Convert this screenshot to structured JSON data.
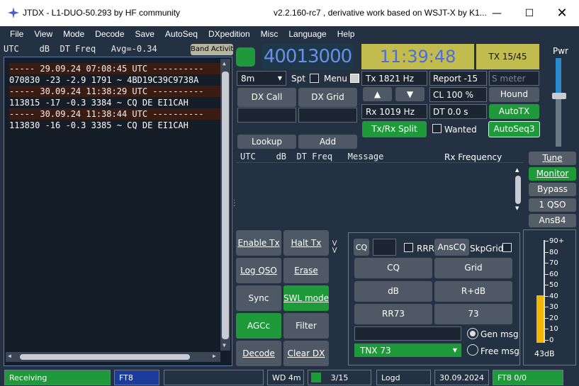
{
  "window": {
    "title": "JTDX - L1-DUO-50.293  by HF community",
    "version_text": "v2.2.160-rc7 , derivative work based on WSJT-X by K1..."
  },
  "menu": [
    "File",
    "View",
    "Mode",
    "Decode",
    "Save",
    "AutoSeq",
    "DXpedition",
    "Misc",
    "Language",
    "Help"
  ],
  "band_activity": {
    "header": "UTC    dB  DT Freq   Avg=-0.34",
    "header_button": "Band Activity",
    "lines": [
      {
        "text": "----- 29.09.24 07:08:45 UTC ----------",
        "sep": true
      },
      {
        "text": "070830 -23 -2.9 1791 ~ 4BD19C39C9738A",
        "sep": false
      },
      {
        "text": "----- 30.09.24 11:38:29 UTC ----------",
        "sep": true
      },
      {
        "text": "113815 -17 -0.3 3384 ~ CQ DE EI1CAH",
        "sep": false
      },
      {
        "text": "----- 30.09.24 11:38:44 UTC ----------",
        "sep": true
      },
      {
        "text": "113830 -16 -0.3 3385 ~ CQ DE EI1CAH",
        "sep": false
      }
    ]
  },
  "frequency": "40013000",
  "clock": "11:39:48",
  "tx_counter": "TX 15/45",
  "pwr_label": "Pwr",
  "band": "8m",
  "spt_label": "Spt",
  "menu_label": "Menu",
  "tx_freq": "Tx  1821  Hz",
  "rx_freq": "Rx  1019  Hz",
  "report": "Report -15",
  "smeter_placeholder": "S meter",
  "cl": "CL  100 %",
  "dt": "DT 0.0 s",
  "hound": "Hound",
  "autotx": "AutoTX",
  "autoseq3": "AutoSeq3",
  "wanted": "Wanted",
  "txrx_split": "Tx/Rx Split",
  "dx_call_btn": "DX Call",
  "dx_grid_btn": "DX Grid",
  "lookup": "Lookup",
  "add": "Add",
  "rx_freq_hdr": "UTC    dB  DT Freq   Message",
  "rx_freq_label": "Rx Frequency",
  "right_buttons": [
    "Tune",
    "Monitor",
    "Bypass",
    "1 QSO",
    "AnsB4"
  ],
  "left_buttons": [
    "Enable Tx",
    "Halt Tx",
    "Log QSO",
    "Erase",
    "Sync",
    "SWL mode",
    "AGCc",
    "Filter",
    "Decode",
    "Clear DX"
  ],
  "tx_panel": {
    "cq_small": "CQ",
    "rrr": "RRR",
    "anscq": "AnsCQ",
    "skpgrid": "SkpGrid",
    "grid_btns": [
      "CQ",
      "Grid",
      "dB",
      "R+dB",
      "RR73",
      "73"
    ],
    "gen_msg": "Gen msg",
    "free_msg": "Free msg",
    "tnx": "TNX 73",
    "arrows_label": "<<"
  },
  "meter": {
    "ticks": [
      "90+",
      "80",
      "70",
      "60",
      "50",
      "40",
      "30",
      "20",
      "10",
      "0"
    ],
    "reading": "43dB",
    "level_pct": 43
  },
  "status": {
    "receiving": "Receiving",
    "mode": "FT8",
    "wd": "WD 4m",
    "progress": "3/15",
    "progress_frac": 0.2,
    "logd": "Logd",
    "date": "30.09.2024",
    "ft8": "FT8  0/0"
  }
}
